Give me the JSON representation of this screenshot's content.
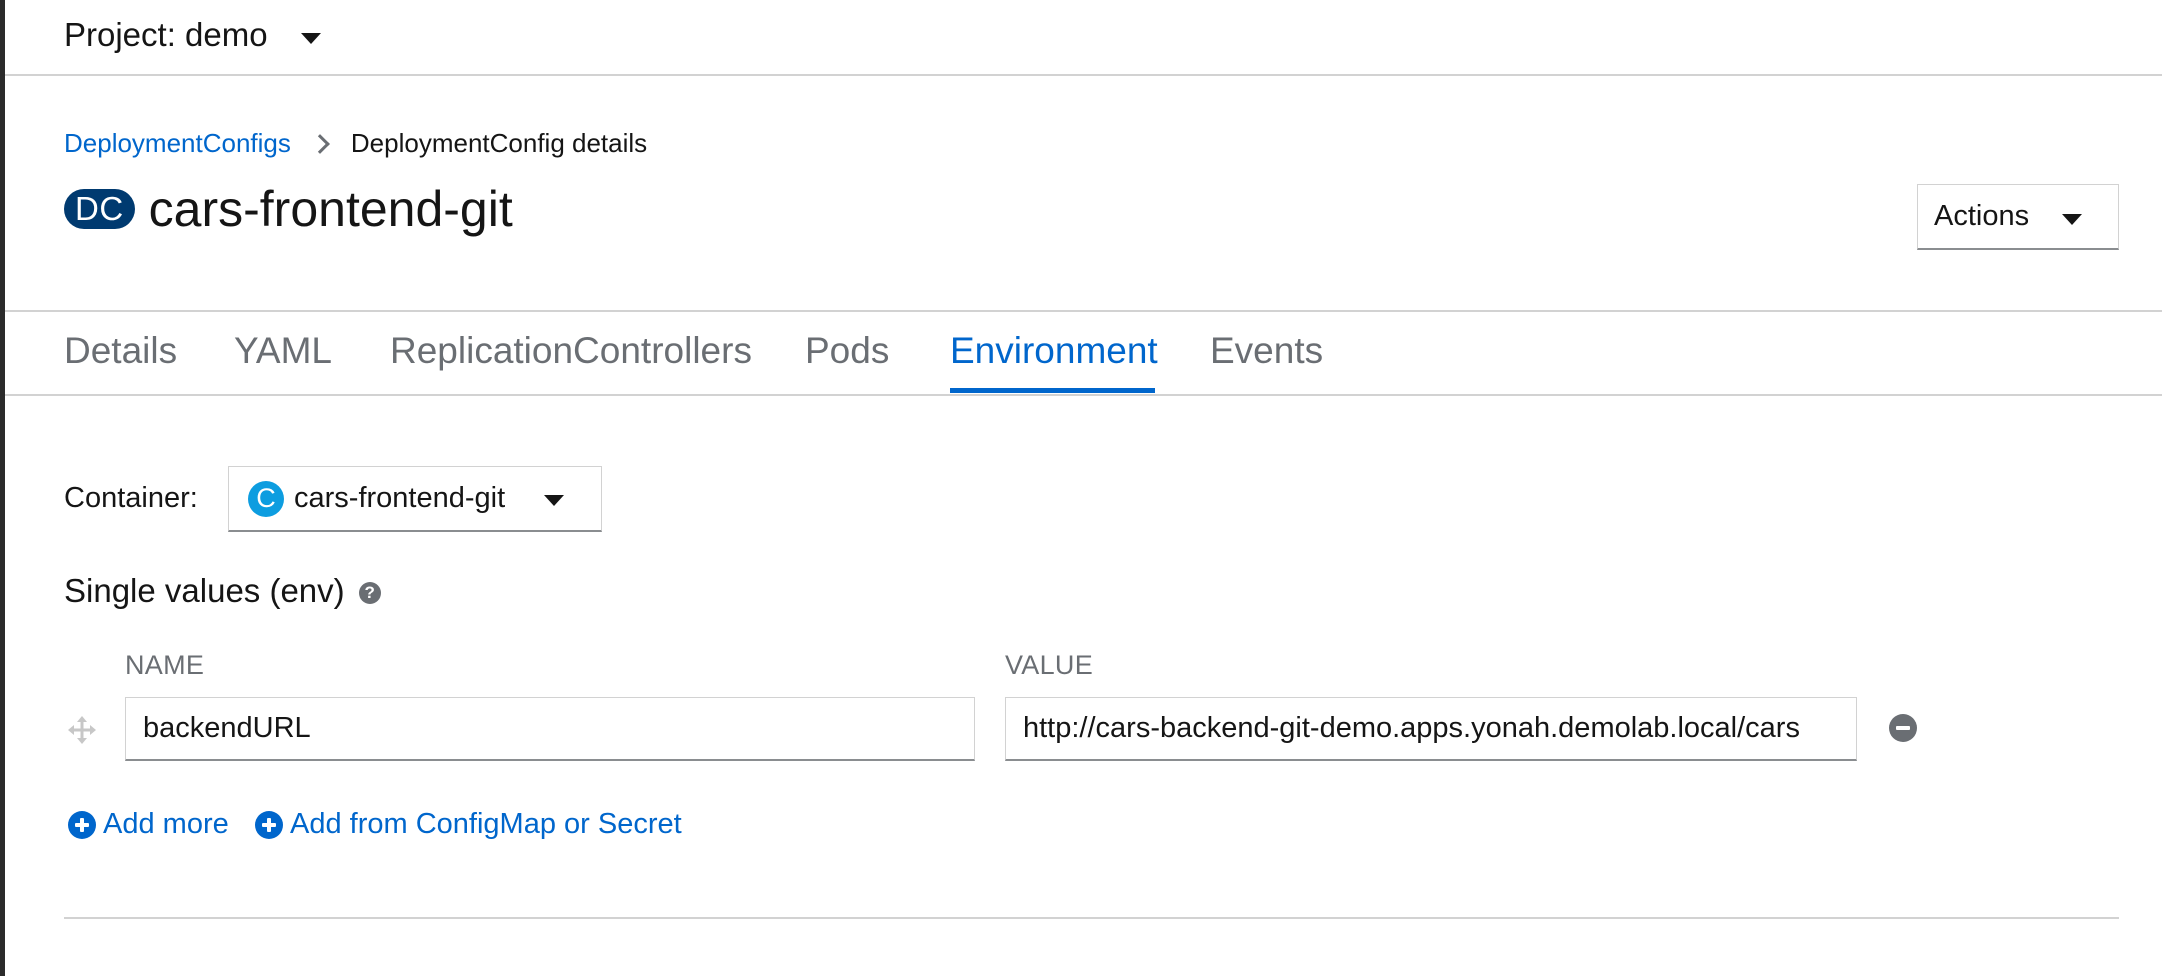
{
  "project_bar": {
    "label": "Project: demo"
  },
  "breadcrumb": {
    "parent": "DeploymentConfigs",
    "current": "DeploymentConfig details"
  },
  "header": {
    "badge": "DC",
    "title": "cars-frontend-git",
    "actions_label": "Actions"
  },
  "tabs": [
    {
      "label": "Details",
      "active": false
    },
    {
      "label": "YAML",
      "active": false
    },
    {
      "label": "ReplicationControllers",
      "active": false
    },
    {
      "label": "Pods",
      "active": false
    },
    {
      "label": "Environment",
      "active": true
    },
    {
      "label": "Events",
      "active": false
    }
  ],
  "container": {
    "label": "Container:",
    "icon_letter": "C",
    "selected": "cars-frontend-git"
  },
  "env_section": {
    "heading": "Single values (env)",
    "help_icon": "?",
    "name_header": "NAME",
    "value_header": "VALUE",
    "rows": [
      {
        "name": "backendURL",
        "value": "http://cars-backend-git-demo.apps.yonah.demolab.local/cars"
      }
    ],
    "add_more_label": "Add more",
    "add_from_label": "Add from ConfigMap or Secret"
  },
  "colors": {
    "link": "#0066cc",
    "badge_bg": "#003a70",
    "container_icon": "#0d9de0",
    "muted": "#6a6e73"
  },
  "icons": [
    "chevron-down-icon",
    "breadcrumb-chevron-icon",
    "container-c-icon",
    "help-icon",
    "drag-handle-icon",
    "minus-circle-icon",
    "plus-circle-icon"
  ]
}
